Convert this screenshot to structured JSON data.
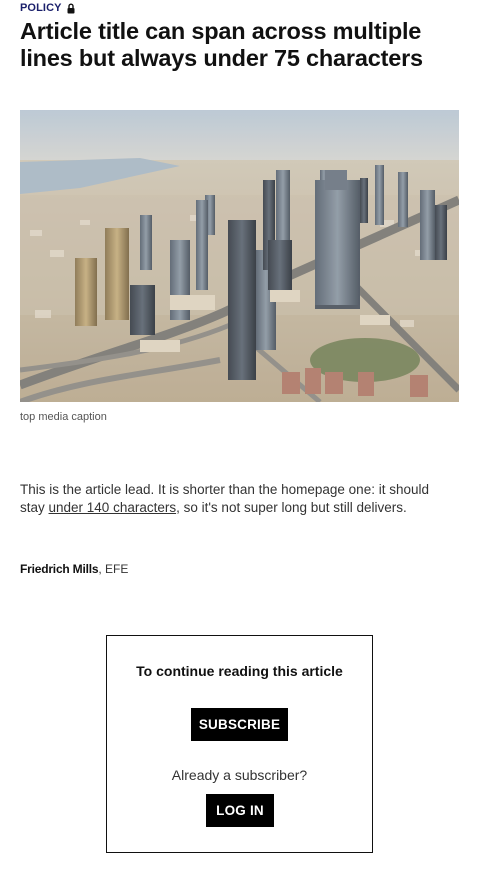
{
  "section": {
    "label": "POLICY",
    "lock_icon": "lock-icon",
    "color": "#1a1f6b"
  },
  "article": {
    "title": "Article title can span across multiple lines but always under 75 characters",
    "media_caption": "top media caption",
    "lead_before": "This is the article lead. It is shorter than the homepage one: it should stay ",
    "lead_link": "under 140 characters",
    "lead_after": ", so it's not super long but still delivers.",
    "author": "Friedrich Mills",
    "agency": ", EFE"
  },
  "paywall": {
    "title": "To continue reading this article",
    "subscribe_label": "SUBSCRIBE",
    "already_text": "Already a subscriber?",
    "login_label": "LOG IN"
  }
}
